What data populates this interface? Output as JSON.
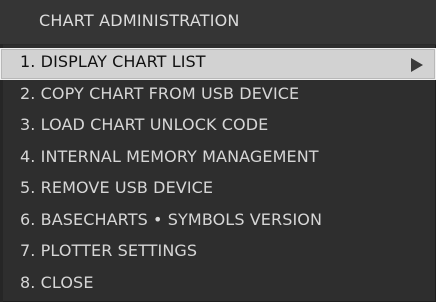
{
  "menu": {
    "title": "CHART ADMINISTRATION",
    "items": [
      {
        "label": "1. DISPLAY CHART LIST",
        "selected": true
      },
      {
        "label": "2. COPY CHART FROM USB DEVICE"
      },
      {
        "label": "3. LOAD CHART UNLOCK CODE"
      },
      {
        "label": "4. INTERNAL MEMORY MANAGEMENT"
      },
      {
        "label": "5. REMOVE USB DEVICE"
      },
      {
        "label": "6. BASECHARTS • SYMBOLS VERSION"
      },
      {
        "label": "7. PLOTTER SETTINGS"
      },
      {
        "label": "8. CLOSE"
      }
    ],
    "submenu_icon": "play-arrow-icon"
  }
}
